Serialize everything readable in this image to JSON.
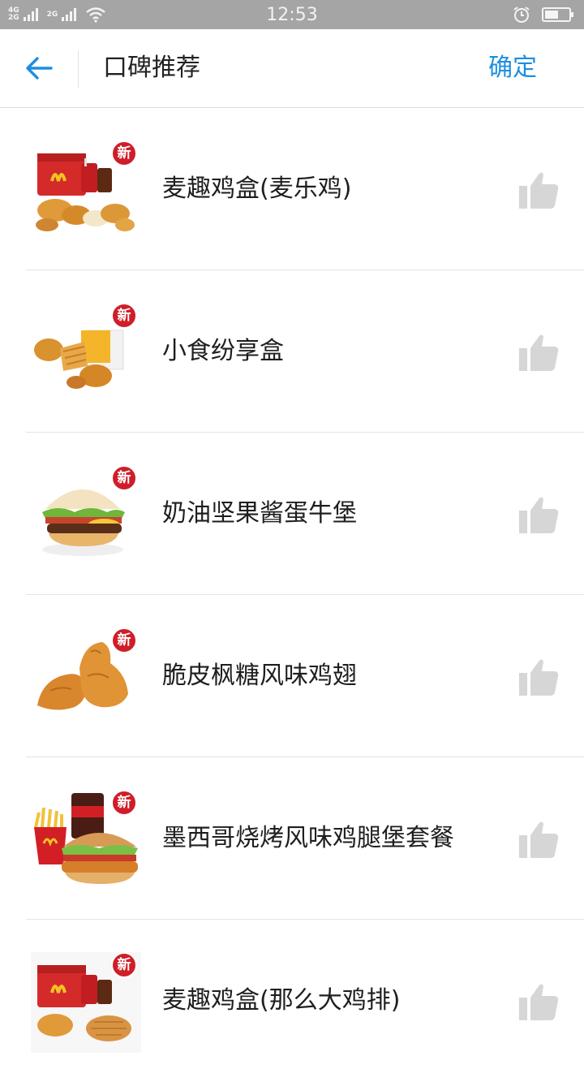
{
  "status_bar": {
    "network_top": "4G",
    "network_bottom": "2G",
    "network2": "2G",
    "time": "12:53",
    "icons": [
      "signal-icon",
      "wifi-icon",
      "alarm-icon",
      "battery-icon"
    ]
  },
  "header": {
    "title": "口碑推荐",
    "confirm_label": "确定",
    "back_icon": "back-arrow-icon",
    "accent_color": "#1e8ee0"
  },
  "badge_label": "新",
  "items": [
    {
      "name": "麦趣鸡盒(麦乐鸡)",
      "image": "chicken-box-meal",
      "badge": "新"
    },
    {
      "name": "小食纷享盒",
      "image": "snack-share-box",
      "badge": "新"
    },
    {
      "name": "奶油坚果酱蛋牛堡",
      "image": "beef-egg-burger",
      "badge": "新"
    },
    {
      "name": "脆皮枫糖风味鸡翅",
      "image": "chicken-wings",
      "badge": "新"
    },
    {
      "name": "墨西哥烧烤风味鸡腿堡套餐",
      "image": "chicken-burger-combo",
      "badge": "新"
    },
    {
      "name": "麦趣鸡盒(那么大鸡排)",
      "image": "chicken-box-cutlet",
      "badge": "新"
    }
  ],
  "like_icon": "thumbs-up-icon",
  "colors": {
    "status_bar_bg": "#a5a5a5",
    "badge_red": "#cf1e2a",
    "like_gray": "#d6d6d6"
  }
}
